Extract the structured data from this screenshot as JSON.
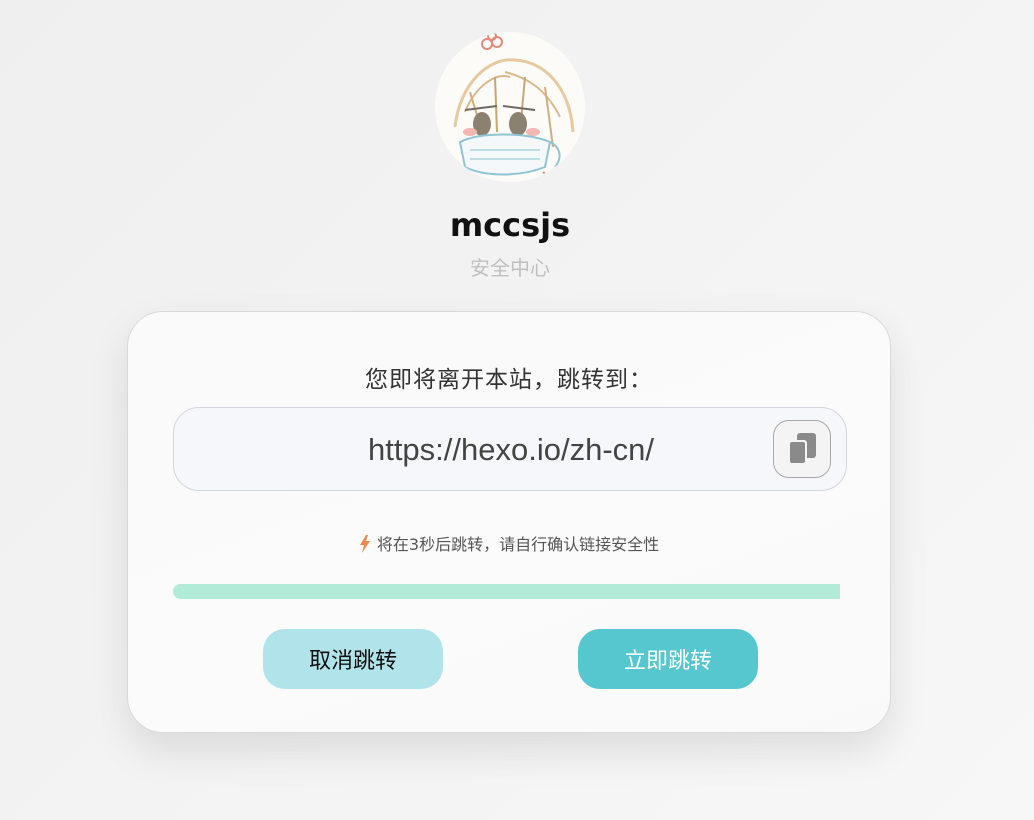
{
  "header": {
    "avatar_icon": "anime-avatar-icon",
    "site_name": "mccsjs",
    "subtitle": "安全中心"
  },
  "card": {
    "leave_text": "您即将离开本站，跳转到：",
    "url": "https://hexo.io/zh-cn/",
    "copy_icon": "copy-icon",
    "notice_icon": "lightning-icon",
    "notice_text": "将在3秒后跳转，请自行确认链接安全性",
    "progress": 1.0,
    "cancel_label": "取消跳转",
    "go_label": "立即跳转"
  },
  "colors": {
    "progress": "#b2ecd8",
    "cancel_button": "#b0e4ea",
    "go_button": "#56c6cf",
    "bolt": "#f08a4b"
  }
}
